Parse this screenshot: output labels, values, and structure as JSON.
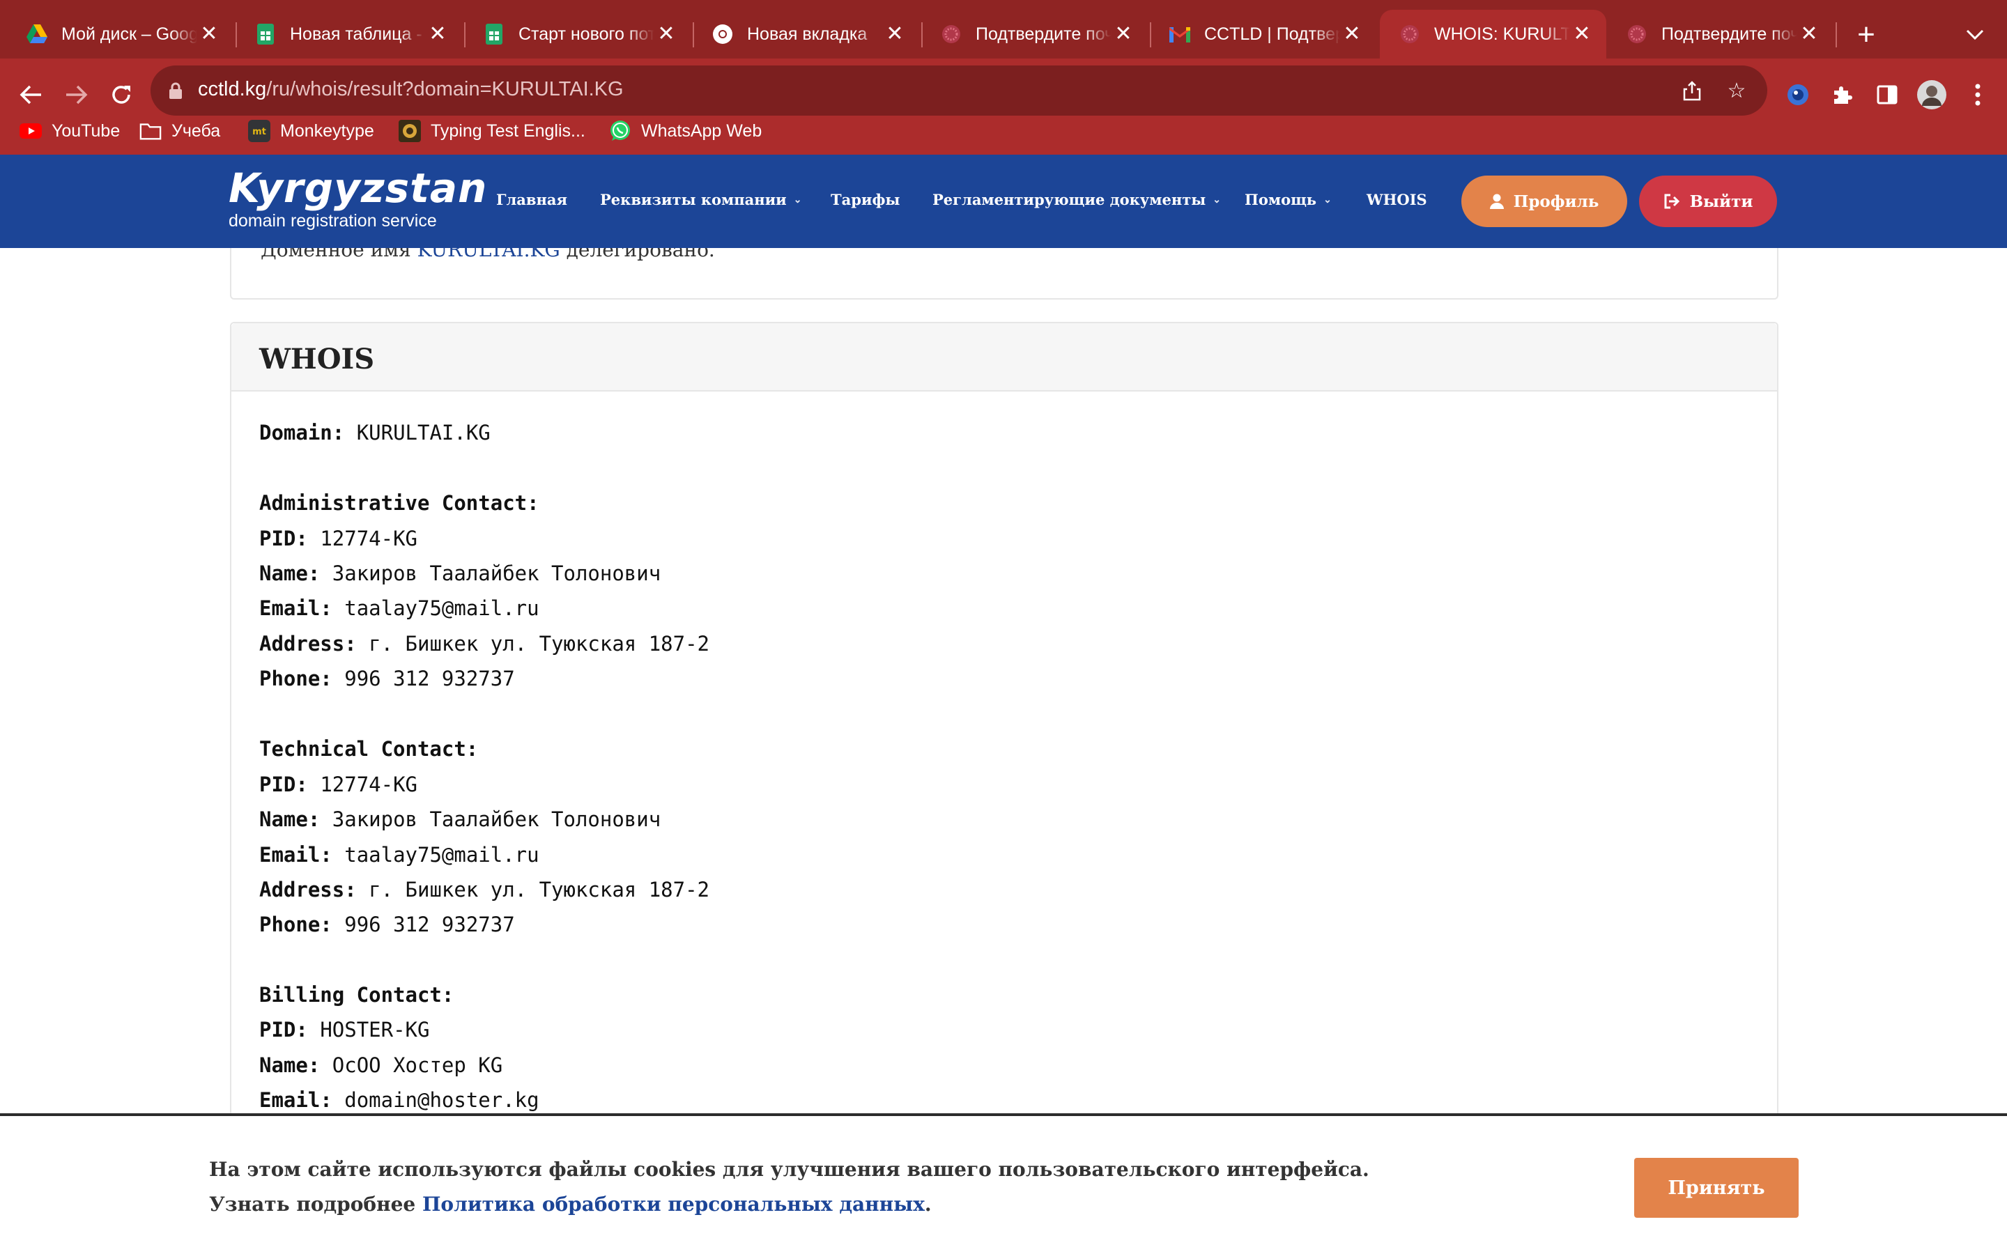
{
  "browser": {
    "tabs": [
      {
        "title": "Мой диск – Google Диск",
        "icon": "google-drive-icon"
      },
      {
        "title": "Новая таблица - Google Таблицы",
        "icon": "google-sheets-icon"
      },
      {
        "title": "Старт нового потока",
        "icon": "google-sheets-icon"
      },
      {
        "title": "Новая вкладка",
        "icon": "chrome-icon"
      },
      {
        "title": "Подтвердите почту",
        "icon": "cctld-icon"
      },
      {
        "title": "CCTLD | Подтвердите почту",
        "icon": "gmail-icon"
      },
      {
        "title": "WHOIS: KURULTAI.KG",
        "icon": "cctld-icon"
      },
      {
        "title": "Подтвердите почту",
        "icon": "cctld-icon"
      }
    ],
    "active_tab": 6,
    "url_host": "cctld.kg",
    "url_path": "/ru/whois/result?domain=KURULTAI.KG",
    "bookmarks": [
      {
        "label": "YouTube",
        "icon": "youtube-icon"
      },
      {
        "label": "Учеба",
        "icon": "folder-icon"
      },
      {
        "label": "Monkeytype",
        "icon": "monkeytype-icon"
      },
      {
        "label": "Typing Test Englis...",
        "icon": "typing-test-icon"
      },
      {
        "label": "WhatsApp Web",
        "icon": "whatsapp-icon"
      }
    ]
  },
  "site": {
    "logo_main": "Kyrgyzstan",
    "logo_sub": "domain registration service",
    "nav": [
      {
        "label": "Главная",
        "dropdown": false
      },
      {
        "label": "Реквизиты компании",
        "dropdown": true
      },
      {
        "label": "Тарифы",
        "dropdown": false
      },
      {
        "label": "Регламентирующие документы",
        "dropdown": true
      },
      {
        "label": "Помощь",
        "dropdown": true
      },
      {
        "label": "WHOIS",
        "dropdown": false
      }
    ],
    "profile_label": "Профиль",
    "logout_label": "Выйти",
    "colors": {
      "header": "#1c4597",
      "profile": "#e3834a",
      "logout": "#cf3844"
    }
  },
  "content": {
    "delegated_prefix": "Доменное имя ",
    "delegated_domain": "KURULTAI.KG",
    "delegated_suffix": " делегировано.",
    "whois_title": "WHOIS",
    "domain_label": "Domain:",
    "domain_value": "KURULTAI.KG",
    "contacts": [
      {
        "heading": "Administrative Contact:",
        "fields": [
          {
            "label": "PID:",
            "value": "12774-KG"
          },
          {
            "label": "Name:",
            "value": "Закиров Таалайбек Толонович"
          },
          {
            "label": "Email:",
            "value": "taalay75@mail.ru"
          },
          {
            "label": "Address:",
            "value": "г. Бишкек ул. Туюкская 187-2"
          },
          {
            "label": "Phone:",
            "value": "996 312 932737"
          }
        ]
      },
      {
        "heading": "Technical Contact:",
        "fields": [
          {
            "label": "PID:",
            "value": "12774-KG"
          },
          {
            "label": "Name:",
            "value": "Закиров Таалайбек Толонович"
          },
          {
            "label": "Email:",
            "value": "taalay75@mail.ru"
          },
          {
            "label": "Address:",
            "value": "г. Бишкек ул. Туюкская 187-2"
          },
          {
            "label": "Phone:",
            "value": "996 312 932737"
          }
        ]
      },
      {
        "heading": "Billing Contact:",
        "fields": [
          {
            "label": "PID:",
            "value": "HOSTER-KG"
          },
          {
            "label": "Name:",
            "value": "ОсОО Хостер KG"
          },
          {
            "label": "Email:",
            "value": "domain@hoster.kg"
          }
        ]
      }
    ]
  },
  "cookie": {
    "line1": "На этом сайте используются файлы cookies для улучшения вашего пользовательского интерфейса.",
    "line2_prefix": "Узнать подробнее ",
    "line2_link": "Политика обработки персональных данных",
    "line2_suffix": ".",
    "accept_label": "Принять"
  }
}
